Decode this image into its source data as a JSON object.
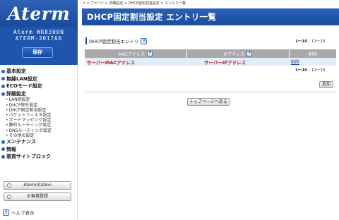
{
  "sidebar": {
    "logo": "Aterm",
    "model_line1": "Aterm WR8300N",
    "model_line2": "ATERM-3017A6",
    "save_label": "保存",
    "nav": {
      "basic": "基本設定",
      "wireless": "無線LAN設定",
      "eco": "ECOモード設定",
      "detail": "詳細設定",
      "lan": "LAN側設定",
      "dhcp_exclude": "DHCP除外設定",
      "dhcp_fixed": "DHCP固定割当設定",
      "packet_filter": "パケットフィルタ設定",
      "port_mapping": "ポートマッピング設定",
      "static_routing": "静的ルーティング設定",
      "dns_routing": "DNSルーティング設定",
      "other": "その他の設定",
      "maintenance": "メンテナンス",
      "info": "情報",
      "malicious_block": "悪質サイトブロック"
    },
    "aterm_station": "AtermStation",
    "favorites": "お客様登録",
    "help": "ヘルプ表示",
    "help_icon": "?"
  },
  "breadcrumb": "トップページ > 詳細設定 > DHCP固定割当設定 > エントリ一覧",
  "page_title": "DHCP固定割当設定 エントリ一覧",
  "section_title": "DHCP固定割当エントリ",
  "pager": {
    "current": "1〜10",
    "separator": "|",
    "next": "11〜20"
  },
  "table": {
    "headers": {
      "mac": "MACアドレス",
      "ip": "IPアドレス",
      "delete": "削除"
    },
    "rows": [
      {
        "mac": "サーバーMACアドレス",
        "ip": "サーバーIPアドレス",
        "delete": "削除"
      }
    ]
  },
  "add_label": "追加",
  "top_page_label": "トップページへ戻る",
  "colors": {
    "header_blue": "#1a4c9e",
    "accent_red": "#b11a16",
    "row_bg": "#e2ecfa",
    "table_header": "#a9a9a9"
  }
}
